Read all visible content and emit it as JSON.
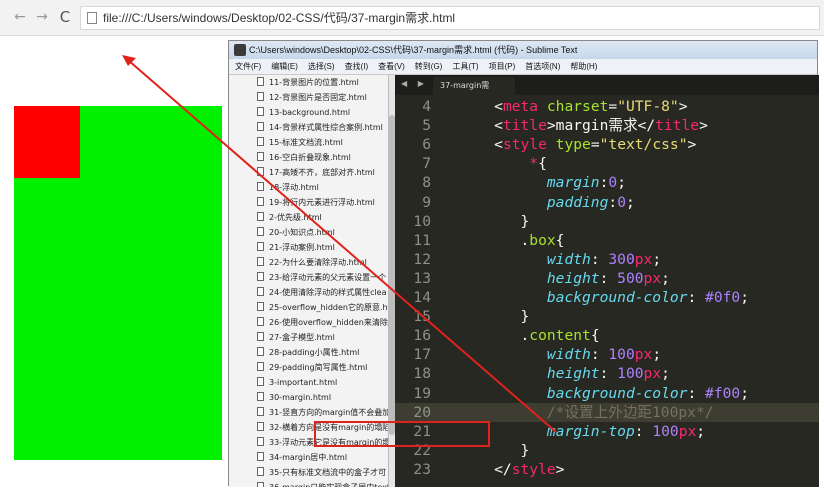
{
  "browser": {
    "address_url": "file:///C:/Users/windows/Desktop/02-CSS/代码/37-margin需求.html",
    "back_glyph": "←",
    "forward_glyph": "→",
    "reload_glyph": "C"
  },
  "page_preview": {
    "box_color": "#00f000",
    "content_color": "#ff0000"
  },
  "sublime": {
    "window_title": "C:\\Users\\windows\\Desktop\\02-CSS\\代码\\37-margin需求.html (代码) - Sublime Text",
    "menu": [
      "文件(F)",
      "编辑(E)",
      "选择(S)",
      "查找(I)",
      "查看(V)",
      "转到(G)",
      "工具(T)",
      "项目(P)",
      "首选项(N)",
      "帮助(H)"
    ],
    "tab_arrows": "◀ ▶",
    "active_tab": "37-margin需求.html",
    "files": [
      "11-背景图片的位置.html",
      "12-背景图片是否固定.html",
      "13-background.html",
      "14-背景样式属性综合案例.html",
      "15-标准文档流.html",
      "16-空白折叠现象.html",
      "17-高矮不齐，底部对齐.html",
      "18-浮动.html",
      "19-将行内元素进行浮动.html",
      "2-优先级.html",
      "20-小知识点.html",
      "21-浮动案例.html",
      "22-为什么要清除浮动.html",
      "23-给浮动元素的父元素设置一个",
      "24-使用清除浮动的样式属性clea",
      "25-overflow_hidden它的原意.ht",
      "26-使用overflow_hidden来清除",
      "27-盒子模型.html",
      "28-padding小属性.html",
      "29-padding简写属性.html",
      "3-important.html",
      "30-margin.html",
      "31-竖直方向的margin值不会叠加",
      "32-横着方向是没有margin的塌陷",
      "33-浮动元素它是没有margin的塌",
      "34-margin居中.html",
      "35-只有标准文档流中的盒子才可",
      "36-margin只能实现盒子居中text",
      "37-margin需求.html"
    ],
    "selected_file_index": 28,
    "code_lines": [
      {
        "num": "4",
        "parts": [
          [
            "t-punc",
            "    <"
          ],
          [
            "t-tag",
            "meta"
          ],
          [
            "t-punc",
            " "
          ],
          [
            "t-attr",
            "charset"
          ],
          [
            "t-punc",
            "="
          ],
          [
            "t-str",
            "\"UTF-8\""
          ],
          [
            "t-punc",
            ">"
          ]
        ]
      },
      {
        "num": "5",
        "parts": [
          [
            "t-punc",
            "    <"
          ],
          [
            "t-tag",
            "title"
          ],
          [
            "t-punc",
            ">margin需求</"
          ],
          [
            "t-tag",
            "title"
          ],
          [
            "t-punc",
            ">"
          ]
        ]
      },
      {
        "num": "6",
        "parts": [
          [
            "t-punc",
            "    <"
          ],
          [
            "t-tag",
            "style"
          ],
          [
            "t-punc",
            " "
          ],
          [
            "t-attr",
            "type"
          ],
          [
            "t-punc",
            "="
          ],
          [
            "t-str",
            "\"text/css\""
          ],
          [
            "t-punc",
            ">"
          ]
        ]
      },
      {
        "num": "7",
        "parts": [
          [
            "t-punc",
            "        "
          ],
          [
            "t-tag",
            "*"
          ],
          [
            "t-punc",
            "{"
          ]
        ]
      },
      {
        "num": "8",
        "parts": [
          [
            "t-punc",
            "          "
          ],
          [
            "t-prop",
            "margin"
          ],
          [
            "t-punc",
            ":"
          ],
          [
            "t-num",
            "0"
          ],
          [
            "t-punc",
            ";"
          ]
        ]
      },
      {
        "num": "9",
        "parts": [
          [
            "t-punc",
            "          "
          ],
          [
            "t-prop",
            "padding"
          ],
          [
            "t-punc",
            ":"
          ],
          [
            "t-num",
            "0"
          ],
          [
            "t-punc",
            ";"
          ]
        ]
      },
      {
        "num": "10",
        "parts": [
          [
            "t-punc",
            "       }"
          ]
        ]
      },
      {
        "num": "11",
        "parts": [
          [
            "t-punc",
            "       ."
          ],
          [
            "t-sel",
            "box"
          ],
          [
            "t-punc",
            "{"
          ]
        ]
      },
      {
        "num": "12",
        "parts": [
          [
            "t-punc",
            "          "
          ],
          [
            "t-prop",
            "width"
          ],
          [
            "t-punc",
            ": "
          ],
          [
            "t-num",
            "300"
          ],
          [
            "t-unit",
            "px"
          ],
          [
            "t-punc",
            ";"
          ]
        ]
      },
      {
        "num": "13",
        "parts": [
          [
            "t-punc",
            "          "
          ],
          [
            "t-prop",
            "height"
          ],
          [
            "t-punc",
            ": "
          ],
          [
            "t-num",
            "500"
          ],
          [
            "t-unit",
            "px"
          ],
          [
            "t-punc",
            ";"
          ]
        ]
      },
      {
        "num": "14",
        "parts": [
          [
            "t-punc",
            "          "
          ],
          [
            "t-prop",
            "background-color"
          ],
          [
            "t-punc",
            ": "
          ],
          [
            "t-num",
            "#0f0"
          ],
          [
            "t-punc",
            ";"
          ]
        ]
      },
      {
        "num": "15",
        "parts": [
          [
            "t-punc",
            "       }"
          ]
        ]
      },
      {
        "num": "16",
        "parts": [
          [
            "t-punc",
            "       ."
          ],
          [
            "t-sel",
            "content"
          ],
          [
            "t-punc",
            "{"
          ]
        ]
      },
      {
        "num": "17",
        "parts": [
          [
            "t-punc",
            "          "
          ],
          [
            "t-prop",
            "width"
          ],
          [
            "t-punc",
            ": "
          ],
          [
            "t-num",
            "100"
          ],
          [
            "t-unit",
            "px"
          ],
          [
            "t-punc",
            ";"
          ]
        ]
      },
      {
        "num": "18",
        "parts": [
          [
            "t-punc",
            "          "
          ],
          [
            "t-prop",
            "height"
          ],
          [
            "t-punc",
            ": "
          ],
          [
            "t-num",
            "100"
          ],
          [
            "t-unit",
            "px"
          ],
          [
            "t-punc",
            ";"
          ]
        ]
      },
      {
        "num": "19",
        "parts": [
          [
            "t-punc",
            "          "
          ],
          [
            "t-prop",
            "background-color"
          ],
          [
            "t-punc",
            ": "
          ],
          [
            "t-num",
            "#f00"
          ],
          [
            "t-punc",
            ";"
          ]
        ]
      },
      {
        "num": "20",
        "parts": [
          [
            "t-punc",
            "          "
          ],
          [
            "t-comment",
            "/*设置上外边距100px*/"
          ]
        ]
      },
      {
        "num": "21",
        "parts": [
          [
            "t-punc",
            "          "
          ],
          [
            "t-prop",
            "margin-top"
          ],
          [
            "t-punc",
            ": "
          ],
          [
            "t-num",
            "100"
          ],
          [
            "t-unit",
            "px"
          ],
          [
            "t-punc",
            ";"
          ]
        ]
      },
      {
        "num": "22",
        "parts": [
          [
            "t-punc",
            "       }"
          ]
        ]
      },
      {
        "num": "23",
        "parts": [
          [
            "t-punc",
            "    </"
          ],
          [
            "t-tag",
            "style"
          ],
          [
            "t-punc",
            ">"
          ]
        ]
      }
    ],
    "current_line_index": 16
  }
}
